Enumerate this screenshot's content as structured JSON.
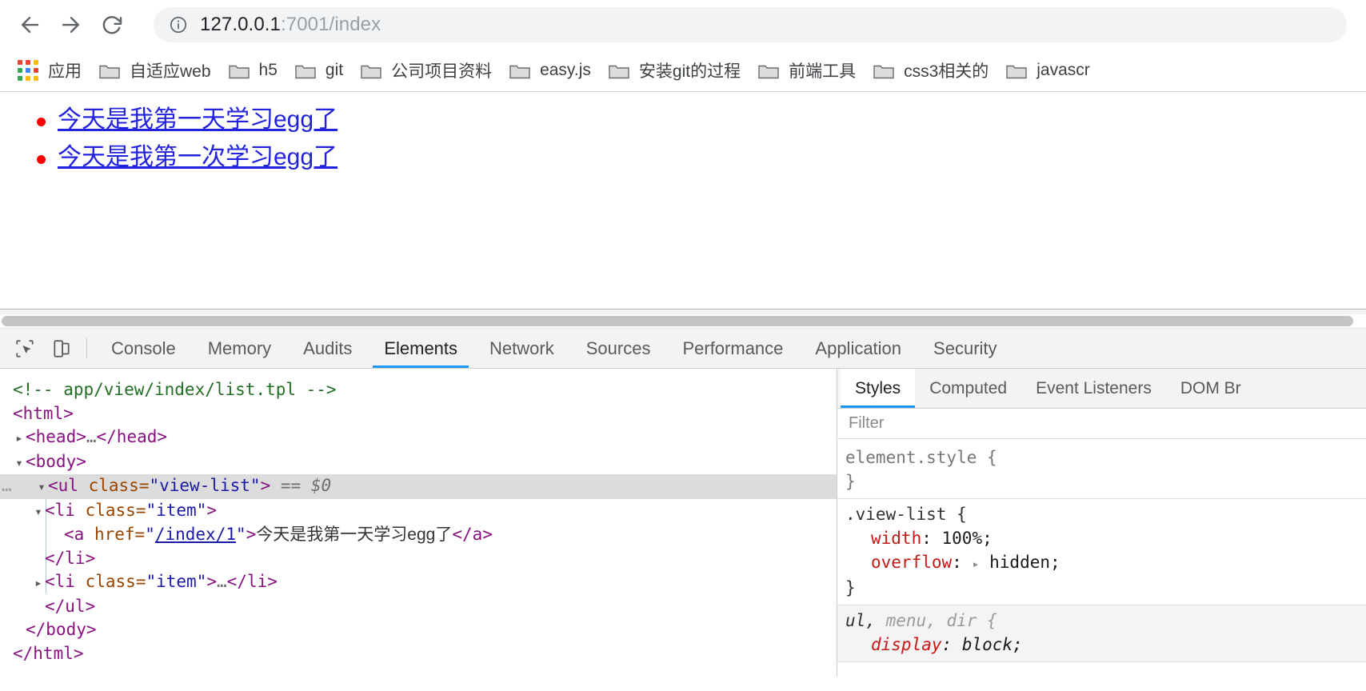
{
  "browser": {
    "nav": {
      "back_label": "Back",
      "forward_label": "Forward",
      "reload_label": "Reload"
    },
    "omnibox": {
      "info_icon": "info-circle-icon",
      "host": "127.0.0.1",
      "path": ":7001/index",
      "url_full": "127.0.0.1:7001/index"
    },
    "bookmarks": [
      {
        "label": "应用",
        "icon": "apps-grid-icon"
      },
      {
        "label": "自适应web",
        "icon": "folder-icon"
      },
      {
        "label": "h5",
        "icon": "folder-icon"
      },
      {
        "label": "git",
        "icon": "folder-icon"
      },
      {
        "label": "公司项目资料",
        "icon": "folder-icon"
      },
      {
        "label": "easy.js",
        "icon": "folder-icon"
      },
      {
        "label": "安装git的过程",
        "icon": "folder-icon"
      },
      {
        "label": "前端工具",
        "icon": "folder-icon"
      },
      {
        "label": "css3相关的",
        "icon": "folder-icon"
      },
      {
        "label": "javascr",
        "icon": "folder-icon"
      }
    ]
  },
  "page": {
    "list": [
      {
        "text": "今天是我第一天学习egg了",
        "href": "/index/1"
      },
      {
        "text": "今天是我第一次学习egg了",
        "href": "/index/2"
      }
    ],
    "bullet_color": "#ff0000",
    "link_color": "#2323dd"
  },
  "devtools": {
    "toolbar": {
      "inspect_icon": "inspect-cursor-icon",
      "device_icon": "device-toolbar-icon"
    },
    "tabs": [
      {
        "label": "Console",
        "active": false
      },
      {
        "label": "Memory",
        "active": false
      },
      {
        "label": "Audits",
        "active": false
      },
      {
        "label": "Elements",
        "active": true
      },
      {
        "label": "Network",
        "active": false
      },
      {
        "label": "Sources",
        "active": false
      },
      {
        "label": "Performance",
        "active": false
      },
      {
        "label": "Application",
        "active": false
      },
      {
        "label": "Security",
        "active": false
      }
    ],
    "active_tab_accent": "#1a9af5",
    "dom": {
      "comment": "<!-- app/view/index/list.tpl -->",
      "l_html_open": "<html>",
      "l_head": {
        "twisty": "▸",
        "open": "<head>",
        "ellipsis": "…",
        "close": "</head>"
      },
      "l_body_open": {
        "twisty": "▾",
        "text": "<body>"
      },
      "l_ul": {
        "gutter": "…",
        "twisty": "▾",
        "tag_open": "<ul",
        "attr": "class",
        "eq": "=",
        "quote": "\"",
        "value": "view-list",
        "tag_close": ">",
        "selected_marker": "== $0"
      },
      "l_li1": {
        "twisty": "▾",
        "tag_open": "<li",
        "attr": "class",
        "value": "item",
        "tag_close": ">"
      },
      "l_a": {
        "tag_open": "<a",
        "attr": "href",
        "value": "/index/1",
        "tag_close": ">",
        "text": "今天是我第一天学习egg了",
        "tag_end": "</a>"
      },
      "l_li1_close": "</li>",
      "l_li2": {
        "twisty": "▸",
        "tag_open": "<li",
        "attr": "class",
        "value": "item",
        "tag_close": ">",
        "ellipsis": "…",
        "tag_end": "</li>"
      },
      "l_ul_close": "</ul>",
      "l_body_close": "</body>",
      "l_html_close": "</html>"
    },
    "styles": {
      "tabs": [
        {
          "label": "Styles",
          "active": true
        },
        {
          "label": "Computed",
          "active": false
        },
        {
          "label": "Event Listeners",
          "active": false
        },
        {
          "label": "DOM Br",
          "active": false
        }
      ],
      "filter_placeholder": "Filter",
      "rules": [
        {
          "selector": "element.style",
          "selector_dim": "",
          "open_brace": "{",
          "close_brace": "}",
          "ua": false,
          "declarations": []
        },
        {
          "selector": ".view-list",
          "selector_dim": "",
          "open_brace": "{",
          "close_brace": "}",
          "ua": false,
          "declarations": [
            {
              "prop": "width",
              "value": "100%",
              "expandable": false
            },
            {
              "prop": "overflow",
              "value": "hidden",
              "expandable": true
            }
          ]
        },
        {
          "selector": "ul,",
          "selector_dim": "menu, dir",
          "open_brace": "{",
          "close_brace": "}",
          "ua": true,
          "declarations": [
            {
              "prop": "display",
              "value": "block",
              "expandable": false
            }
          ]
        }
      ]
    }
  }
}
